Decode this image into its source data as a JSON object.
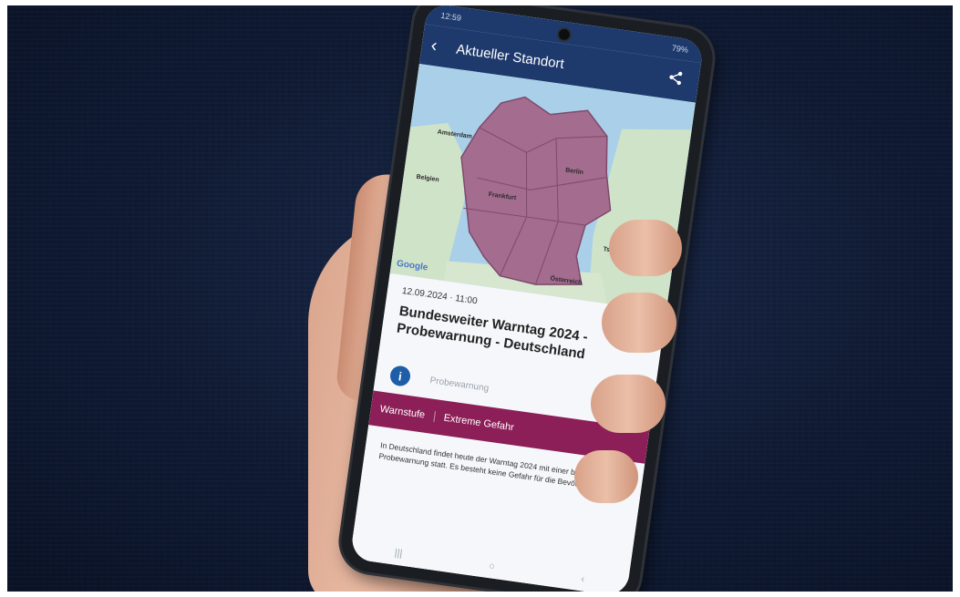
{
  "status_bar": {
    "time": "12:59",
    "battery": "79%"
  },
  "app_bar": {
    "back_icon": "chevron-left-icon",
    "title": "Aktueller Standort",
    "share_icon": "share-icon"
  },
  "map": {
    "labels": {
      "city_1": "Amsterdam",
      "city_2": "Belgien",
      "city_3": "Berlin",
      "city_4": "Frankfurt",
      "city_5": "Tschechien",
      "city_6": "Österreich"
    },
    "attribution": "Google",
    "highlight_color": "#a46c8f"
  },
  "alert": {
    "date": "12.09.2024 · 11:00",
    "headline": "Bundesweiter Warntag 2024 - Probewarnung - Deutschland",
    "type_label": "Probewarnung",
    "level_key": "Warnstufe",
    "level_value": "Extreme Gefahr",
    "level_color": "#8c1f57",
    "body": "In Deutschland findet heute der Warntag 2024 mit einer bundesweiten Probewarnung statt. Es besteht keine Gefahr für die Bevölkerung."
  },
  "nav_bar": {
    "recent": "|||",
    "home": "○",
    "back": "‹"
  }
}
